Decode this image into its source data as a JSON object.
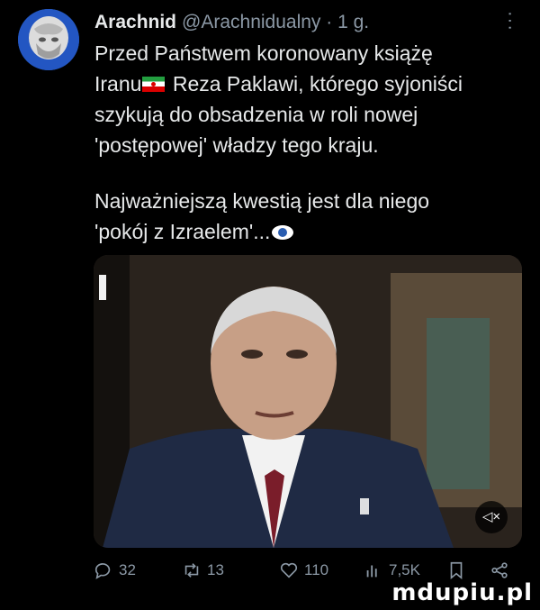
{
  "author": {
    "name": "Arachnid",
    "handle": "@Arachnidualny",
    "time": "· 1 g."
  },
  "tweet": {
    "line1": "Przed Państwem koronowany książę",
    "line2a": "Iranu",
    "line2b": " Reza Paklawi, którego syjoniści",
    "line3": "szykują do obsadzenia w roli nowej",
    "line4": "'postępowej' władzy tego kraju.",
    "line5": "Najważniejszą kwestią jest dla niego",
    "line6": "'pokój z Izraelem'..."
  },
  "actions": {
    "replies": "32",
    "retweets": "13",
    "likes": "110",
    "views": "7,5K"
  },
  "watermark": "mdupiu.pl",
  "icons": [
    "more-icon",
    "flag-iran-icon",
    "eye-icon",
    "mute-icon",
    "reply-icon",
    "retweet-icon",
    "like-icon",
    "views-icon",
    "bookmark-icon",
    "share-icon"
  ],
  "colors": {
    "background": "#000000",
    "text": "#e7e9ea",
    "muted": "#8b98a5"
  }
}
